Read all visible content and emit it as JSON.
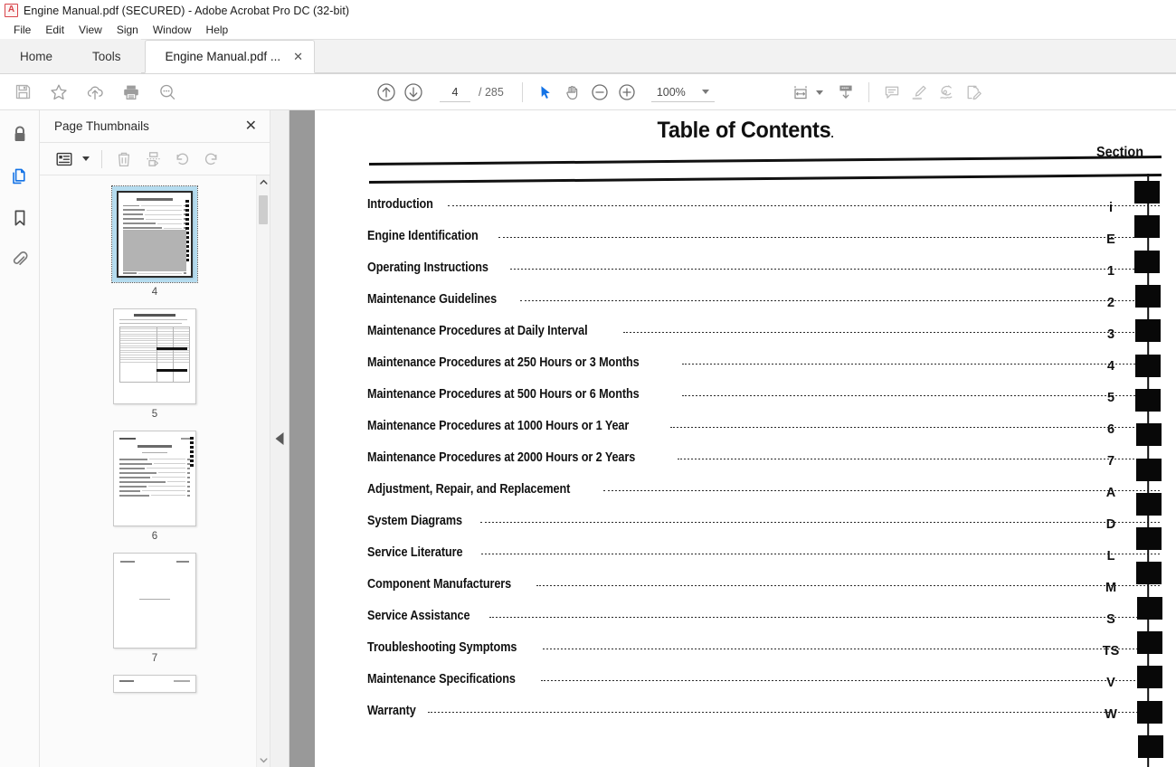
{
  "window": {
    "title": "Engine Manual.pdf (SECURED) - Adobe Acrobat Pro DC (32-bit)",
    "app_icon": "acrobat-icon"
  },
  "menubar": {
    "items": [
      {
        "label": "File"
      },
      {
        "label": "Edit"
      },
      {
        "label": "View"
      },
      {
        "label": "Sign"
      },
      {
        "label": "Window"
      },
      {
        "label": "Help"
      }
    ]
  },
  "tabstrip": {
    "home_label": "Home",
    "tools_label": "Tools",
    "document_tab_label": "Engine Manual.pdf ...",
    "close_glyph": "✕"
  },
  "toolbar": {
    "left_tools": [
      {
        "name": "save-icon",
        "label": "Save"
      },
      {
        "name": "add-to-favorites-icon",
        "label": "Add to Favorites"
      },
      {
        "name": "upload-cloud-icon",
        "label": "Save to cloud"
      },
      {
        "name": "print-icon",
        "label": "Print File"
      },
      {
        "name": "search-icon",
        "label": "Find"
      }
    ],
    "page_up_label": "Previous Page",
    "page_down_label": "Next Page",
    "page_number": "4",
    "page_count": "/ 285",
    "select_tool_label": "Select Tool",
    "hand_tool_label": "Hand Tool",
    "zoom_out_label": "Zoom Out",
    "zoom_in_label": "Zoom In",
    "zoom_value": "100%",
    "fit_page_label": "Fit Page Width",
    "scroll_mode_label": "Page Display",
    "right_tools": [
      {
        "name": "comment-icon",
        "label": "Add Comment"
      },
      {
        "name": "highlighter-icon",
        "label": "Highlight Text"
      },
      {
        "name": "sign-icon",
        "label": "Fill & Sign"
      },
      {
        "name": "request-signature-icon",
        "label": "Request Signatures"
      }
    ]
  },
  "rail": {
    "items": [
      {
        "name": "security-lock-icon",
        "label": "Security Settings",
        "active": false
      },
      {
        "name": "page-thumbnails-icon",
        "label": "Page Thumbnails",
        "active": true
      },
      {
        "name": "bookmarks-icon",
        "label": "Bookmarks",
        "active": false
      },
      {
        "name": "attachments-icon",
        "label": "Attachments",
        "active": false
      }
    ]
  },
  "panel": {
    "title": "Page Thumbnails",
    "close_glyph": "✕",
    "tools": [
      {
        "name": "thumbnail-options-icon",
        "label": "Options"
      },
      {
        "name": "delete-pages-icon",
        "label": "Delete Pages"
      },
      {
        "name": "extract-pages-icon",
        "label": "Extract Pages"
      },
      {
        "name": "rotate-counterclockwise-icon",
        "label": "Rotate Counterclockwise"
      },
      {
        "name": "rotate-clockwise-icon",
        "label": "Rotate Clockwise"
      }
    ],
    "thumbnails": [
      {
        "page": "4",
        "selected": true,
        "kind": "toc"
      },
      {
        "page": "5",
        "selected": false,
        "kind": "table"
      },
      {
        "page": "6",
        "selected": false,
        "kind": "list"
      },
      {
        "page": "7",
        "selected": false,
        "kind": "blank"
      }
    ]
  },
  "document": {
    "title": "Table of Contents",
    "title_trailing_mark": ".",
    "section_column_header": "Section",
    "entries": [
      {
        "label": "Introduction",
        "section": "i"
      },
      {
        "label": "Engine Identification",
        "section": "E"
      },
      {
        "label": "Operating Instructions",
        "section": "1"
      },
      {
        "label": "Maintenance Guidelines",
        "section": "2"
      },
      {
        "label": "Maintenance Procedures at Daily Interval",
        "section": "3"
      },
      {
        "label": "Maintenance Procedures at 250 Hours or 3 Months",
        "section": "4"
      },
      {
        "label": "Maintenance Procedures at 500 Hours or 6 Months",
        "section": "5"
      },
      {
        "label": "Maintenance Procedures at 1000 Hours or 1 Year",
        "section": "6"
      },
      {
        "label": "Maintenance Procedures at 2000 Hours or 2 Years",
        "section": "7"
      },
      {
        "label": "Adjustment, Repair, and Replacement",
        "section": "A"
      },
      {
        "label": "System Diagrams",
        "section": "D"
      },
      {
        "label": "Service Literature",
        "section": "L"
      },
      {
        "label": "Component Manufacturers",
        "section": "M"
      },
      {
        "label": "Service Assistance",
        "section": "S"
      },
      {
        "label": "Troubleshooting Symptoms",
        "section": "TS"
      },
      {
        "label": "Maintenance Specifications",
        "section": "V"
      },
      {
        "label": "Warranty",
        "section": "W"
      }
    ],
    "edge_tab_marker_count": 17
  },
  "colors": {
    "accent_blue": "#1473e6",
    "selection_blue": "#b5dcef",
    "gutter_gray": "#999999",
    "toolbar_icon": "#9a9a9a",
    "acrobat_red": "#d8444a"
  }
}
